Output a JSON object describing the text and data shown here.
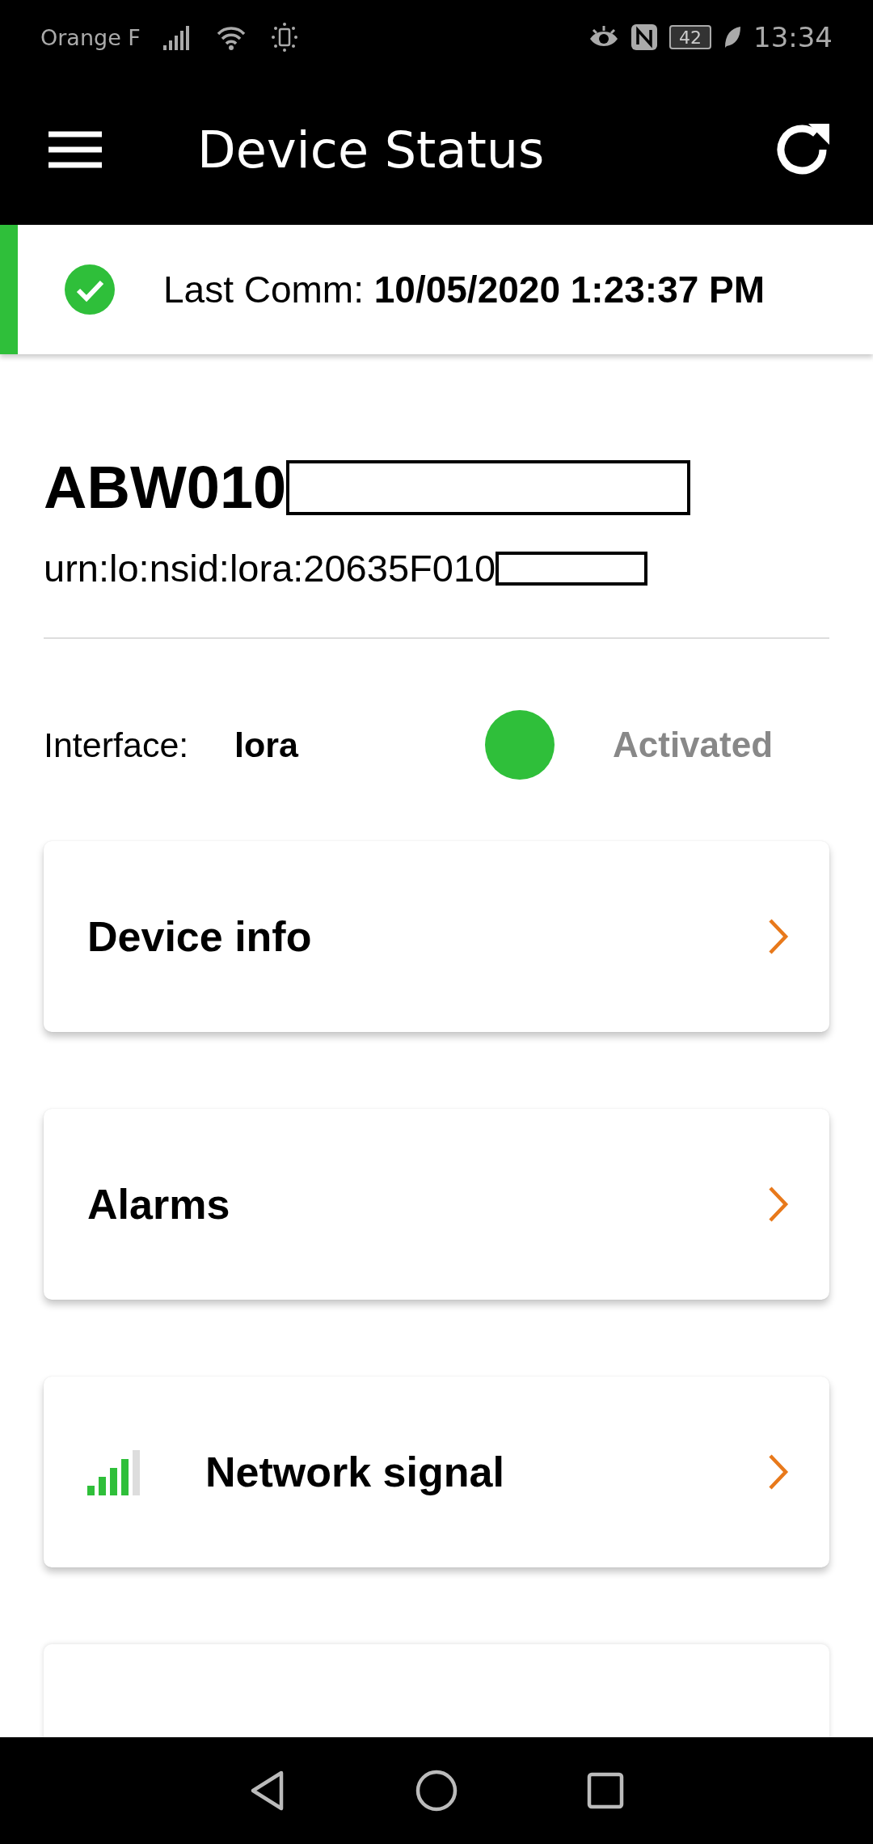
{
  "status_bar": {
    "carrier": "Orange F",
    "battery": "42",
    "time": "13:34"
  },
  "app_bar": {
    "title": "Device Status"
  },
  "last_comm": {
    "label": "Last Comm:",
    "value": "10/05/2020 1:23:37 PM",
    "ok": true
  },
  "device": {
    "name": "ABW010",
    "urn": "urn:lo:nsid:lora:20635F010"
  },
  "interface": {
    "label": "Interface:",
    "value": "lora",
    "activated": true,
    "status": "Activated"
  },
  "cards": [
    {
      "kind": "plain",
      "title": "Device info"
    },
    {
      "kind": "plain",
      "title": "Alarms"
    },
    {
      "kind": "signal",
      "title": "Network signal"
    },
    {
      "kind": "partial"
    }
  ]
}
